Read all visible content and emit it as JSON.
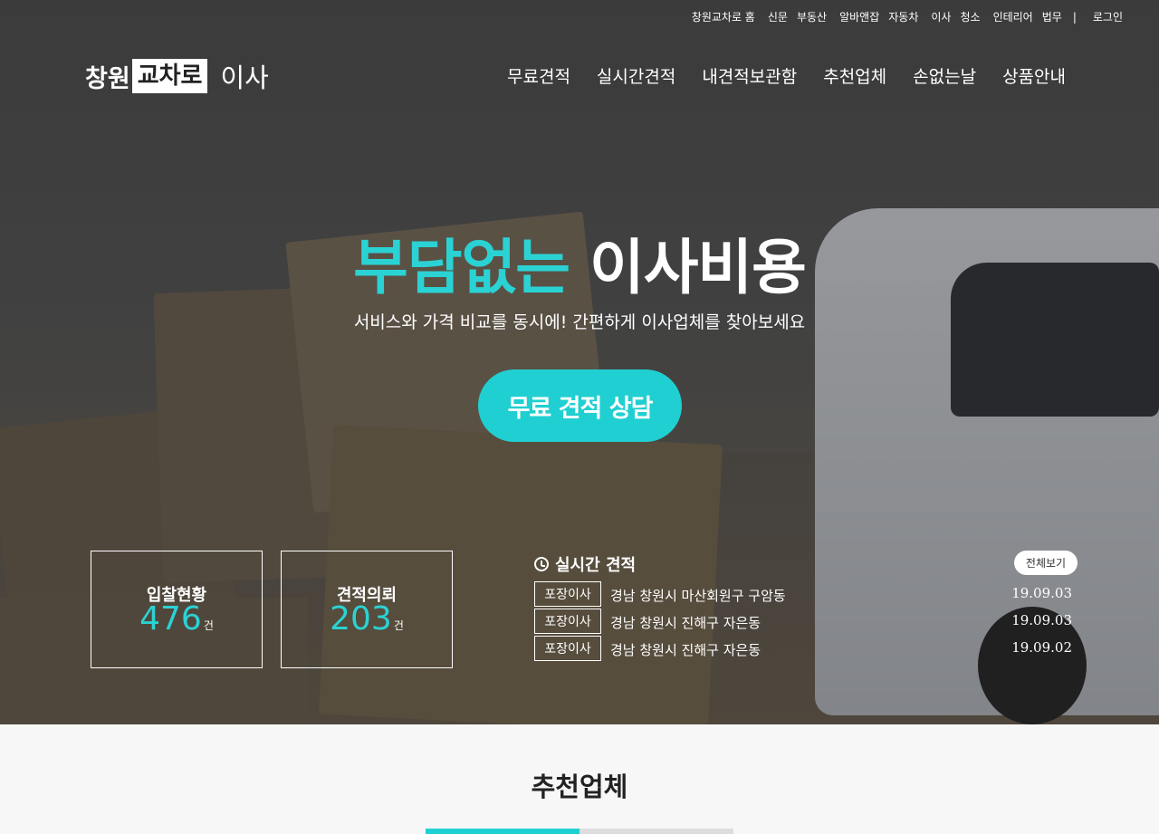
{
  "topbar": {
    "links": [
      "창원교차로 홈",
      "신문",
      "부동산",
      "알바앤잡",
      "자동차",
      "이사",
      "청소",
      "인테리어",
      "법무"
    ],
    "separator": "|",
    "login": "로그인"
  },
  "logo": {
    "part1": "창원",
    "part2": "교차로",
    "part3": "이사"
  },
  "nav": [
    "무료견적",
    "실시간견적",
    "내견적보관함",
    "추천업체",
    "손없는날",
    "상품안내"
  ],
  "hero": {
    "headline_accent": "부담없는",
    "headline_rest": "이사비용",
    "subline": "서비스와 가격 비교를 동시에! 간편하게 이사업체를 찾아보세요",
    "cta": "무료 견적 상담"
  },
  "stats": [
    {
      "label": "입찰현황",
      "value": "476",
      "unit": "건"
    },
    {
      "label": "견적의뢰",
      "value": "203",
      "unit": "건"
    }
  ],
  "realtime": {
    "title": "실시간 견적",
    "view_all": "전체보기",
    "rows": [
      {
        "tag": "포장이사",
        "address": "경남 창원시 마산회원구 구암동",
        "date": "19.09.03"
      },
      {
        "tag": "포장이사",
        "address": "경남 창원시 진해구 자은동",
        "date": "19.09.03"
      },
      {
        "tag": "포장이사",
        "address": "경남 창원시 진해구 자은동",
        "date": "19.09.02"
      }
    ]
  },
  "section": {
    "title": "추천업체"
  },
  "colors": {
    "accent": "#20cfd2"
  }
}
